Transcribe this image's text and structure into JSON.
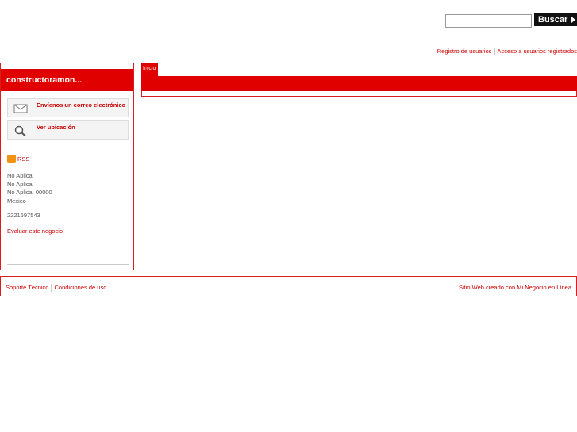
{
  "search": {
    "placeholder": "",
    "button_label": "Buscar"
  },
  "toplinks": {
    "register": "Registro de usuarios",
    "login": "Acceso a usuarios registrados"
  },
  "sidebar": {
    "title": "constructoramon...",
    "email_label": "Envíenos un correo electrónico",
    "location_label": "Ver ubicación",
    "rss_label": "RSS",
    "address": [
      "No Aplica",
      "No Aplica",
      "No Aplica, 00000",
      "Mexico"
    ],
    "phone": "2221697543",
    "rate_label": "Evaluar este negocio"
  },
  "main": {
    "tab_label": "Inicio"
  },
  "footer": {
    "support": "Soporte Técnico",
    "terms": "Condiciones de uso",
    "credit": "Sitio Web creado con Mi Negocio en Línea"
  },
  "colors": {
    "accent": "#e00000",
    "link": "#cc0000"
  }
}
